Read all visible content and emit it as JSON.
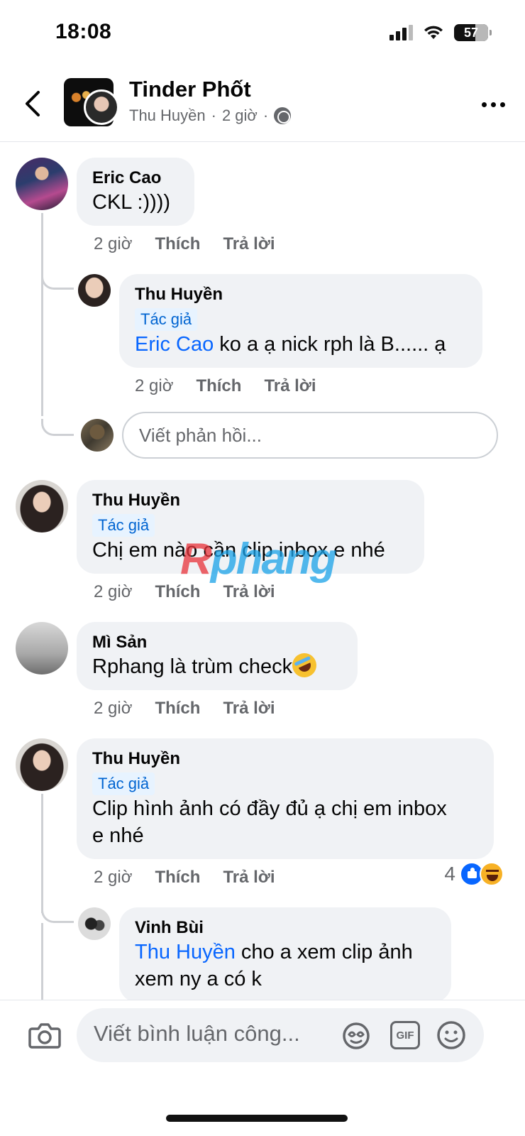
{
  "status": {
    "time": "18:08",
    "battery": "57"
  },
  "header": {
    "title": "Tinder Phốt",
    "author": "Thu Huyền",
    "separator": "·",
    "time": "2 giờ"
  },
  "labels": {
    "like": "Thích",
    "reply": "Trả lời",
    "author_badge": "Tác giả"
  },
  "comments": [
    {
      "name": "Eric Cao",
      "text": "CKL :))))",
      "time": "2 giờ"
    },
    {
      "name": "Thu Huyền",
      "badge": "Tác giả",
      "mention": "Eric Cao",
      "text": "ko a ạ nick rph là B...... ạ",
      "time": "2 giờ"
    },
    {
      "name": "Thu Huyền",
      "badge": "Tác giả",
      "text": "Chị em nào cần clip inbox e nhé",
      "time": "2 giờ"
    },
    {
      "name": "Mì Sản",
      "text": "Rphang là trùm check",
      "time": "2 giờ"
    },
    {
      "name": "Thu Huyền",
      "badge": "Tác giả",
      "text_line1": "Clip hình ảnh có đầy đủ ạ chị em inbox",
      "text_line2": "e nhé",
      "time": "2 giờ",
      "reactions": "4"
    },
    {
      "name": "Vinh Bùi",
      "mention": "Thu Huyền",
      "text_line1": "cho a xem clip ảnh",
      "text_line2": "xem ny a có k"
    }
  ],
  "reply_input": {
    "placeholder": "Viết phản hồi..."
  },
  "watermark": {
    "first": "R",
    "rest": "phang"
  },
  "composer": {
    "placeholder": "Viết bình luận công...",
    "gif": "GIF"
  },
  "icons": {
    "back": "chevron-left-icon",
    "globe": "globe-icon",
    "more": "more-horizontal-icon",
    "camera": "camera-icon",
    "sticker": "sticker-icon",
    "gif": "gif-icon",
    "emoji": "emoji-icon",
    "like": "like-reaction-icon",
    "haha": "haha-reaction-icon"
  },
  "colors": {
    "link": "#0866ff",
    "badge_bg": "#e7f3ff",
    "bubble": "#f0f2f5",
    "muted": "#65676b"
  }
}
